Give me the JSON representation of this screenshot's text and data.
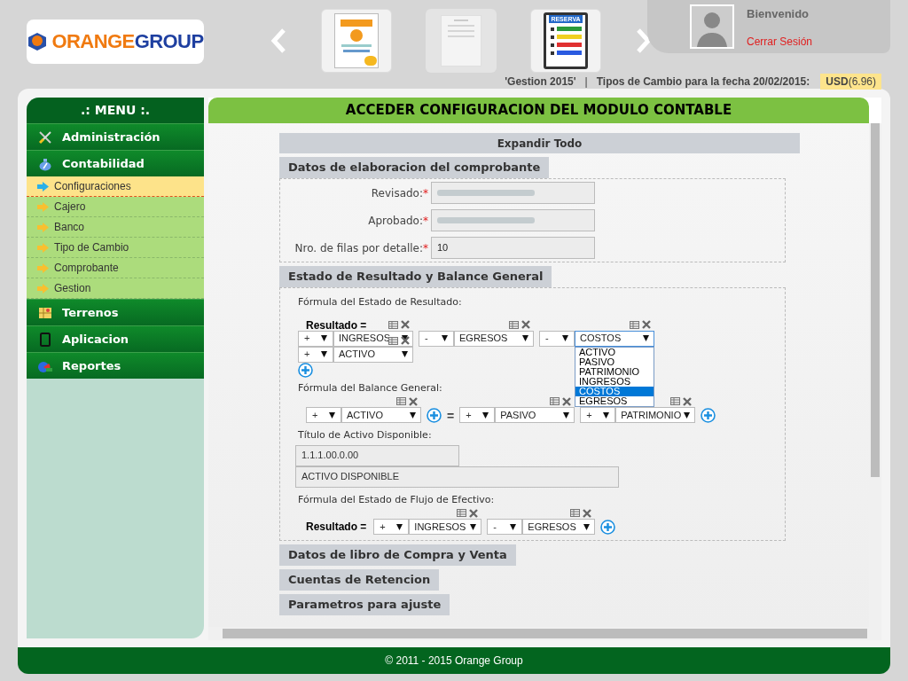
{
  "header": {
    "logo": {
      "brand_a": "ORANGE",
      "brand_b": "GROUP"
    },
    "carousel": [
      {
        "kind": "paycard",
        "faded": false
      },
      {
        "kind": "receipt",
        "faded": true
      },
      {
        "kind": "reserva",
        "caption": "RESERVA",
        "faded": false
      }
    ],
    "user": {
      "greeting": "Bienvenido",
      "logout": "Cerrar Sesión"
    },
    "info": {
      "gestion": "'Gestion 2015'",
      "separator": "|",
      "exchange_label": "Tipos de Cambio para la fecha 20/02/2015:",
      "currency": "USD",
      "rate": "(6.96)"
    }
  },
  "sidebar": {
    "title": ".: MENU :.",
    "items": [
      {
        "label": "Administración",
        "kind": "tools"
      },
      {
        "label": "Contabilidad",
        "kind": "moneybag",
        "children": [
          {
            "label": "Configuraciones",
            "selected": true
          },
          {
            "label": "Cajero",
            "selected": false
          },
          {
            "label": "Banco",
            "selected": false
          },
          {
            "label": "Tipo de Cambio",
            "selected": false
          },
          {
            "label": "Comprobante",
            "selected": false
          },
          {
            "label": "Gestion",
            "selected": false
          }
        ]
      },
      {
        "label": "Terrenos",
        "kind": "map"
      },
      {
        "label": "Aplicacion",
        "kind": "phone"
      },
      {
        "label": "Reportes",
        "kind": "chart"
      }
    ]
  },
  "content": {
    "title": "ACCEDER CONFIGURACION DEL MODULO CONTABLE",
    "expand_all": "Expandir Todo",
    "section1": {
      "title": "Datos de elaboracion del comprobante",
      "fields": [
        {
          "label": "Revisado:",
          "required": "*",
          "redacted": true
        },
        {
          "label": "Aprobado:",
          "required": "*",
          "redacted": true
        },
        {
          "label": "Nro. de filas por detalle:",
          "required": "*",
          "value": "10",
          "redacted": false
        }
      ]
    },
    "section2": {
      "title": "Estado de Resultado y Balance General",
      "resultado": {
        "caption": "Fórmula del Estado de Resultado:",
        "label": "Resultado =",
        "rows": [
          [
            {
              "sign": "+",
              "account": "INGRESOS",
              "open": false
            },
            {
              "sign": "-",
              "account": "EGRESOS",
              "open": false
            },
            {
              "sign": "-",
              "account": "COSTOS",
              "open": true,
              "options": [
                {
                  "label": "ACTIVO",
                  "selected": false
                },
                {
                  "label": "PASIVO",
                  "selected": false
                },
                {
                  "label": "PATRIMONIO",
                  "selected": false
                },
                {
                  "label": "INGRESOS",
                  "selected": false
                },
                {
                  "label": "COSTOS",
                  "selected": true
                },
                {
                  "label": "EGRESOS",
                  "selected": false
                }
              ]
            }
          ],
          [
            {
              "sign": "+",
              "account": "ACTIVO",
              "open": false
            }
          ]
        ]
      },
      "balance": {
        "caption": "Fórmula del Balance General:",
        "equals": "=",
        "left": [
          {
            "sign": "+",
            "account": "ACTIVO",
            "open": false
          }
        ],
        "right": [
          {
            "sign": "+",
            "account": "PASIVO",
            "open": false
          },
          {
            "sign": "+",
            "account": "PATRIMONIO",
            "open": false
          }
        ]
      },
      "disponible": {
        "caption": "Título de Activo Disponible:",
        "code": "1.1.1.00.0.00",
        "name": "ACTIVO DISPONIBLE"
      },
      "flujo": {
        "caption": "Fórmula del Estado de Flujo de Efectivo:",
        "label": "Resultado =",
        "terms": [
          {
            "sign": "+",
            "account": "INGRESOS",
            "open": false
          },
          {
            "sign": "-",
            "account": "EGRESOS",
            "open": false
          }
        ]
      }
    },
    "collapsed_sections": [
      "Datos de libro de Compra y Venta",
      "Cuentas de Retencion",
      "Parametros para ajuste"
    ]
  },
  "footer": "© 2011 - 2015 Orange Group"
}
